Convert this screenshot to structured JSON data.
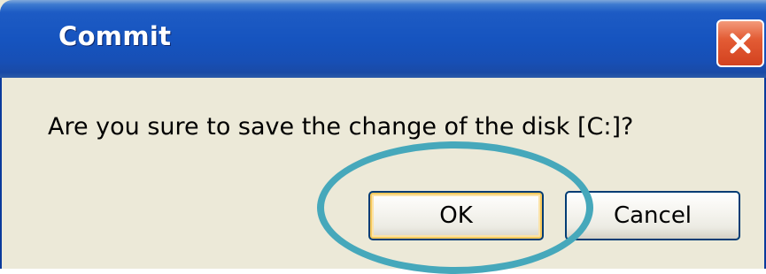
{
  "window": {
    "title": "Commit",
    "close_icon": "close-icon"
  },
  "dialog": {
    "message": "Are you sure to save the change of the disk [C:]?"
  },
  "buttons": {
    "ok_label": "OK",
    "cancel_label": "Cancel"
  },
  "colors": {
    "titlebar": "#1654bf",
    "dialog_bg": "#ece9d8",
    "close_button": "#e35c35",
    "highlight_ring": "#46a8bb",
    "default_button_focus": "#f7c95d"
  }
}
